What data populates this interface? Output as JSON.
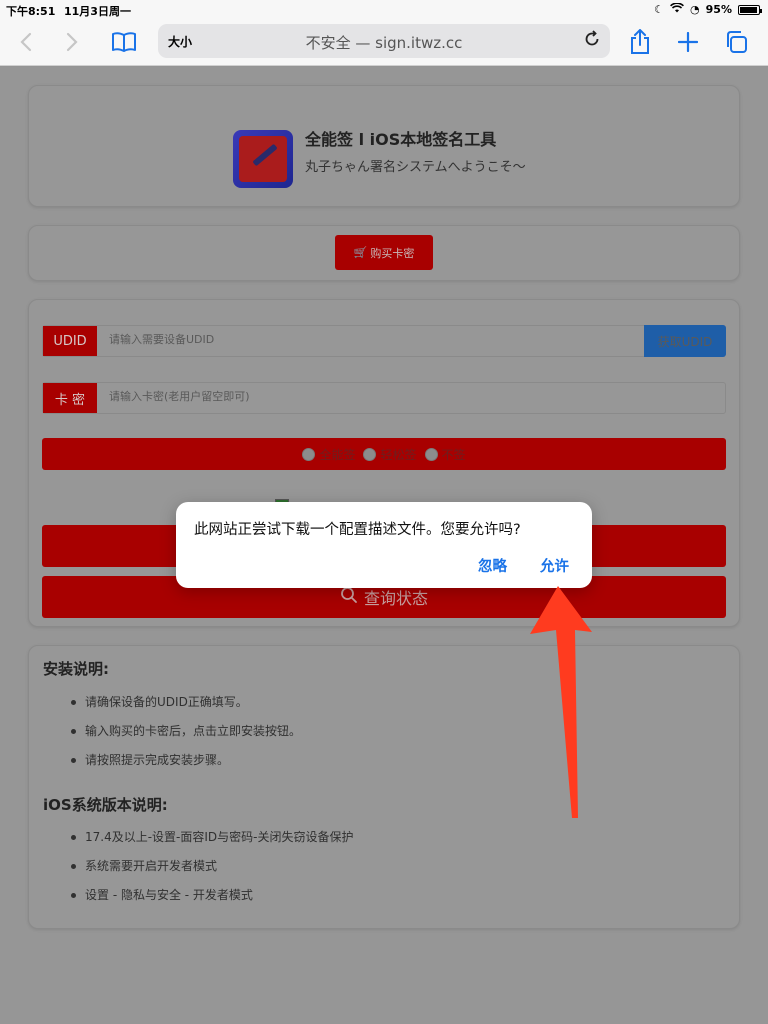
{
  "status_bar": {
    "time": "下午8:51",
    "date": "11月3日周一",
    "battery": "95%",
    "battery_fraction": 0.95
  },
  "browser": {
    "text_size_label": "大小",
    "url": "不安全 — sign.itwz.cc",
    "icons": [
      "back-icon",
      "forward-icon",
      "bookmarks-icon",
      "reload-icon",
      "share-icon",
      "new-tab-icon",
      "tabs-icon"
    ]
  },
  "header": {
    "title": "全能签 l iOS本地签名工具",
    "subtitle": "丸子ちゃん署名システムへようこそ～"
  },
  "buy": {
    "label": "购买卡密"
  },
  "form": {
    "udid_label": "UDID",
    "udid_placeholder": "请输入需要设备UDID",
    "get_udid_label": "获取UDID",
    "card_label": "卡 密",
    "card_placeholder": "请输入卡密(老用户留空即可)",
    "radio_options": [
      "全能签",
      "轻松签",
      "不签"
    ],
    "query_label": "查询状态"
  },
  "instructions": {
    "install_title": "安装说明:",
    "install_items": [
      "请确保设备的UDID正确填写。",
      "输入购买的卡密后，点击立即安装按钮。",
      "请按照提示完成安装步骤。"
    ],
    "ios_title": "iOS系统版本说明:",
    "ios_items": [
      "17.4及以上-设置-面容ID与密码-关闭失窃设备保护",
      "系统需要开启开发者模式",
      "设置 - 隐私与安全 - 开发者模式"
    ]
  },
  "dialog": {
    "message": "此网站正尝试下载一个配置描述文件。您要允许吗?",
    "ignore_label": "忽略",
    "allow_label": "允许"
  },
  "colors": {
    "accent": "#1a73e8",
    "brand_red": "#a80000",
    "arrow": "#ff3b1f"
  }
}
